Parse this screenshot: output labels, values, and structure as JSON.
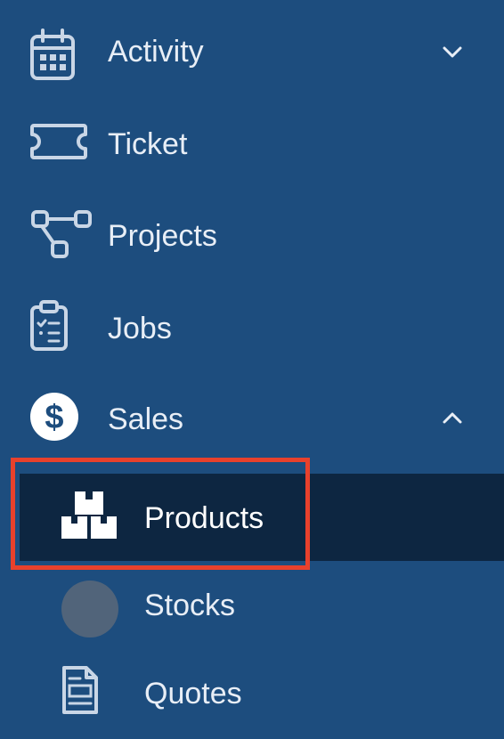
{
  "colors": {
    "sidebar_bg": "#1d4d7e",
    "active_bg": "#0d2641",
    "highlight_border": "#e8412c",
    "icon_stroke": "#c9d6e6"
  },
  "nav": {
    "activity": {
      "label": "Activity",
      "icon": "calendar-icon",
      "chevron": "chevron-down-icon"
    },
    "ticket": {
      "label": "Ticket",
      "icon": "ticket-icon"
    },
    "projects": {
      "label": "Projects",
      "icon": "workflow-icon"
    },
    "jobs": {
      "label": "Jobs",
      "icon": "clipboard-checklist-icon"
    },
    "sales": {
      "label": "Sales",
      "icon": "dollar-circle-icon",
      "chevron": "chevron-up-icon",
      "children": {
        "products": {
          "label": "Products",
          "icon": "boxes-icon",
          "active": true
        },
        "stocks": {
          "label": "Stocks",
          "icon": "avatar"
        },
        "quotes": {
          "label": "Quotes",
          "icon": "document-icon"
        }
      }
    }
  }
}
